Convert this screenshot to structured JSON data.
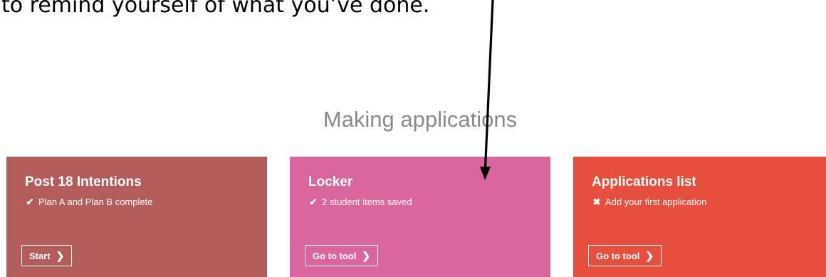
{
  "document": {
    "top_text": "to remind yourself of what you’ve done."
  },
  "section": {
    "title": "Making applications"
  },
  "cards": [
    {
      "title": "Post 18 Intentions",
      "status_icon": "check-icon",
      "status_glyph": "✔",
      "status_text": "Plan A and Plan B complete",
      "button_label": "Start",
      "color": "#b35c5c"
    },
    {
      "title": "Locker",
      "status_icon": "check-icon",
      "status_glyph": "✔",
      "status_text": "2 student items saved",
      "button_label": "Go to tool",
      "color": "#d9679e"
    },
    {
      "title": "Applications list",
      "status_icon": "cross-icon",
      "status_glyph": "✖",
      "status_text": "Add your first application",
      "button_label": "Go to tool",
      "color": "#e64e3e"
    }
  ],
  "button_chevron": "❯",
  "annotation": {
    "arrow_color": "#000000"
  }
}
